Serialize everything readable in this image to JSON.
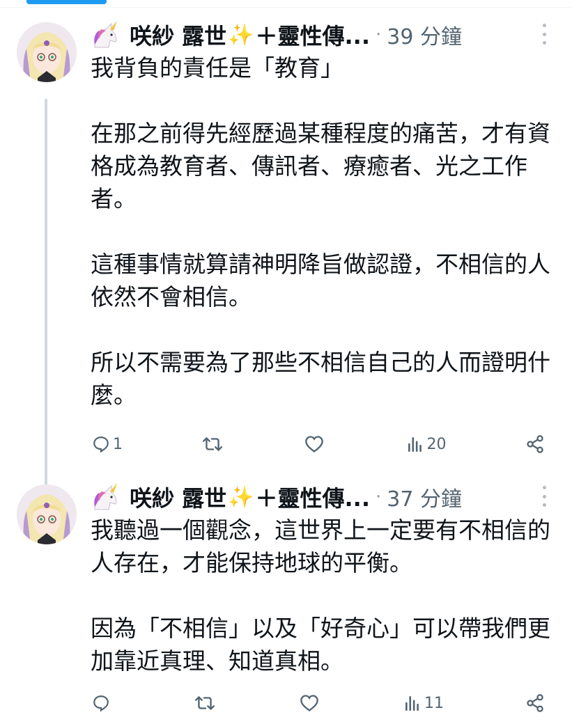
{
  "tweets": [
    {
      "author": "咲紗 露世",
      "sparkle": "✨",
      "author_suffix": "＋靈性傳...",
      "dot": "·",
      "time": "39 分鐘",
      "text": "我背負的責任是「教育」\n\n在那之前得先經歷過某種程度的痛苦，才有資格成為教育者、傳訊者、療癒者、光之工作者。\n\n這種事情就算請神明降旨做認證，不相信的人依然不會相信。\n\n所以不需要為了那些不相信自己的人而證明什麼。",
      "reply_count": "1",
      "retweet_count": "",
      "like_count": "",
      "view_count": "20"
    },
    {
      "author": "咲紗 露世",
      "sparkle": "✨",
      "author_suffix": "＋靈性傳...",
      "dot": "·",
      "time": "37 分鐘",
      "text": "我聽過一個觀念，這世界上一定要有不相信的人存在，才能保持地球的平衡。\n\n因為「不相信」以及「好奇心」可以帶我們更加靠近真理、知道真相。",
      "reply_count": "",
      "retweet_count": "",
      "like_count": "",
      "view_count": "11"
    }
  ],
  "colors": {
    "accent": "#1d9bf0",
    "text": "#0f1419",
    "secondary": "#536471",
    "thread_line": "#cfd9de"
  }
}
